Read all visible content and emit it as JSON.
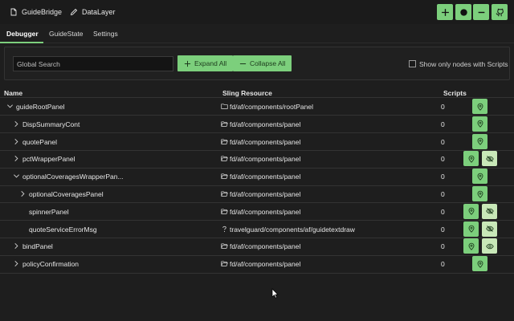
{
  "top_tabs": [
    {
      "label": "GuideBridge",
      "icon": "document-icon"
    },
    {
      "label": "DataLayer",
      "icon": "pencil-icon"
    }
  ],
  "top_actions": [
    {
      "name": "add-button",
      "icon": "plus-icon"
    },
    {
      "name": "record-button",
      "icon": "record-icon"
    },
    {
      "name": "minimize-button",
      "icon": "minus-icon"
    },
    {
      "name": "github-button",
      "icon": "github-icon"
    }
  ],
  "tabs": [
    {
      "label": "Debugger",
      "active": true
    },
    {
      "label": "GuideState",
      "active": false
    },
    {
      "label": "Settings",
      "active": false
    }
  ],
  "toolbar": {
    "search_placeholder": "Global Search",
    "expand_label": "Expand All",
    "collapse_label": "Collapse All",
    "checkbox_label": "Show only nodes with Scripts",
    "checkbox_checked": false
  },
  "table": {
    "headers": {
      "name": "Name",
      "resource": "Sling Resource",
      "scripts": "Scripts"
    },
    "rows": [
      {
        "name": "guideRootPanel",
        "depth": 0,
        "caret": "down",
        "resource": "fd/af/components/rootPanel",
        "res_icon": "folder-icon",
        "count": "0",
        "buttons": [
          "location-pin"
        ]
      },
      {
        "name": "DispSummaryCont",
        "depth": 1,
        "caret": "right",
        "resource": "fd/af/components/panel",
        "res_icon": "folder-open-icon",
        "count": "0",
        "buttons": [
          "location-pin"
        ]
      },
      {
        "name": "quotePanel",
        "depth": 1,
        "caret": "right",
        "resource": "fd/af/components/panel",
        "res_icon": "folder-open-icon",
        "count": "0",
        "buttons": [
          "location-pin"
        ]
      },
      {
        "name": "pctWrapperPanel",
        "depth": 1,
        "caret": "right",
        "resource": "fd/af/components/panel",
        "res_icon": "folder-open-icon",
        "count": "0",
        "buttons": [
          "location-pin",
          "eye-off"
        ]
      },
      {
        "name": "optionalCoveragesWrapperPan...",
        "depth": 1,
        "caret": "down",
        "resource": "fd/af/components/panel",
        "res_icon": "folder-open-icon",
        "count": "0",
        "buttons": [
          "location-pin"
        ]
      },
      {
        "name": "optionalCoveragesPanel",
        "depth": 2,
        "caret": "right",
        "resource": "fd/af/components/panel",
        "res_icon": "folder-open-icon",
        "count": "0",
        "buttons": [
          "location-pin"
        ]
      },
      {
        "name": "spinnerPanel",
        "depth": 2,
        "caret": "none",
        "resource": "fd/af/components/panel",
        "res_icon": "folder-open-icon",
        "count": "0",
        "buttons": [
          "location-pin",
          "eye-off"
        ]
      },
      {
        "name": "quoteServiceErrorMsg",
        "depth": 2,
        "caret": "none",
        "resource": "travelguard/components/af/guidetextdraw",
        "res_icon": "question-icon",
        "count": "0",
        "buttons": [
          "location-pin",
          "eye-off"
        ]
      },
      {
        "name": "bindPanel",
        "depth": 1,
        "caret": "right",
        "resource": "fd/af/components/panel",
        "res_icon": "folder-open-icon",
        "count": "0",
        "buttons": [
          "location-pin",
          "eye"
        ]
      },
      {
        "name": "policyConfirmation",
        "depth": 1,
        "caret": "right",
        "resource": "fd/af/components/panel",
        "res_icon": "folder-open-icon",
        "count": "0",
        "buttons": [
          "location-pin"
        ]
      }
    ]
  },
  "colors": {
    "accent": "#7ccf7c",
    "accent_light": "#c8e8b8",
    "background": "#1e1e1e"
  }
}
